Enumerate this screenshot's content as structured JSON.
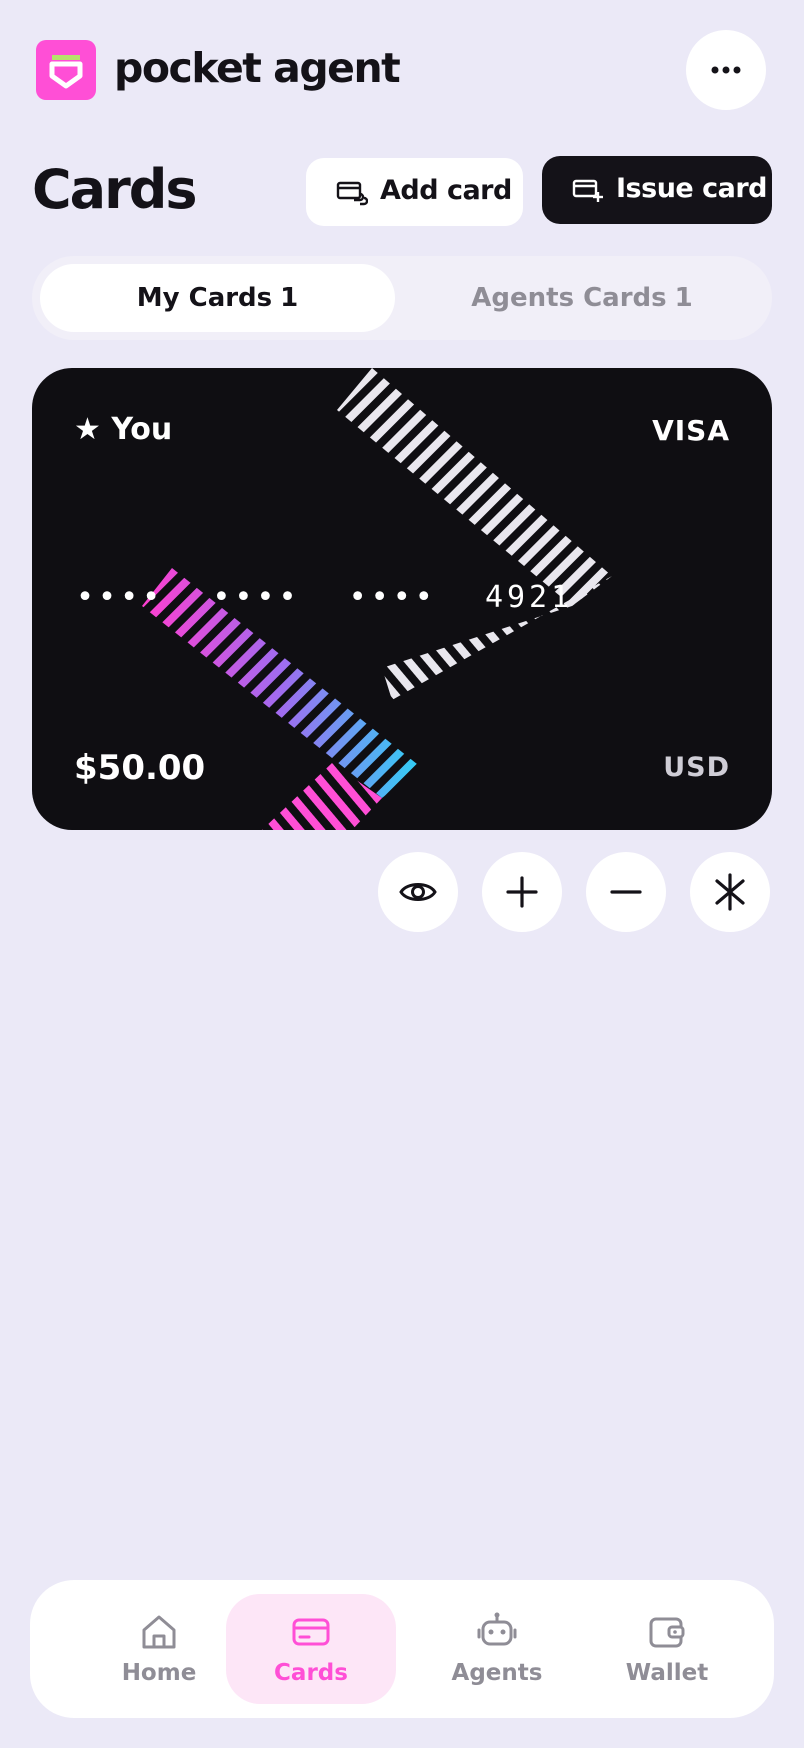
{
  "header": {
    "brand": "pocket agent",
    "logo_icon": "pocket-logo-icon",
    "menu_icon": "more-horizontal-icon"
  },
  "page": {
    "title": "Cards",
    "add_card_label": "Add card",
    "issue_card_label": "Issue card"
  },
  "tabs": [
    {
      "label": "My Cards",
      "count": "1",
      "active": true
    },
    {
      "label": "Agents Cards",
      "count": "1",
      "active": false
    }
  ],
  "card": {
    "owner": "★ You",
    "network": "VISA",
    "number_groups": [
      "••••",
      "••••",
      "••••",
      "4921"
    ],
    "balance": "$50.00",
    "currency": "USD"
  },
  "card_actions": [
    {
      "icon": "eye-icon"
    },
    {
      "icon": "plus-icon"
    },
    {
      "icon": "minus-icon"
    },
    {
      "icon": "asterisk-icon"
    }
  ],
  "nav": [
    {
      "label": "Home",
      "icon": "home-icon",
      "active": false
    },
    {
      "label": "Cards",
      "icon": "card-icon",
      "active": true
    },
    {
      "label": "Agents",
      "icon": "robot-icon",
      "active": false
    },
    {
      "label": "Wallet",
      "icon": "wallet-icon",
      "active": false
    }
  ],
  "colors": {
    "background": "#ebe9f7",
    "accent": "#ff4fd6",
    "dark": "#141218",
    "muted": "#8f8d96"
  }
}
